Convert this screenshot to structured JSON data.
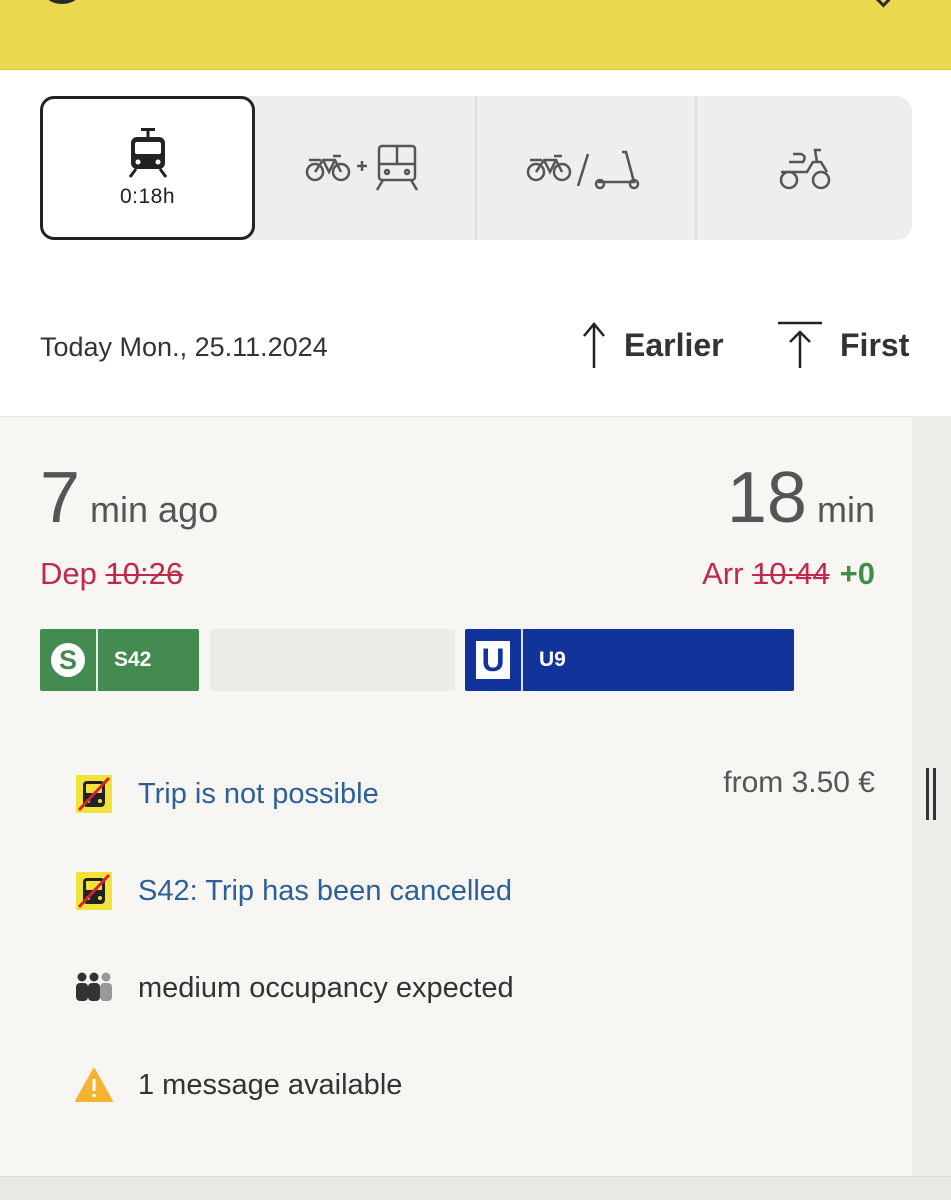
{
  "modes": {
    "public_transport": {
      "duration": "0:18h"
    }
  },
  "date_bar": {
    "date_text": "Today Mon., 25.11.2024",
    "earlier_label": "Earlier",
    "first_label": "First"
  },
  "trip": {
    "departure_relative_value": "7",
    "departure_relative_unit": "min ago",
    "arrival_relative_value": "18",
    "arrival_relative_unit": "min",
    "departure_prefix": "Dep",
    "departure_time": "10:26",
    "arrival_prefix": "Arr",
    "arrival_time": "10:44",
    "arrival_delay": "+0",
    "legs": [
      {
        "badge": "S",
        "line": "S42",
        "color": "#438b51"
      },
      {
        "badge": "U",
        "line": "U9",
        "color": "#12339a"
      }
    ],
    "price": "from 3.50  €",
    "infos": [
      {
        "text": "Trip is not possible",
        "icon": "cancelled-icon"
      },
      {
        "text": "S42: Trip has been cancelled",
        "icon": "cancelled-icon"
      },
      {
        "text": "medium occupancy expected",
        "icon": "occupancy-icon"
      },
      {
        "text": "1 message available",
        "icon": "warning-icon"
      }
    ]
  },
  "colors": {
    "header_yellow": "#ebd84e",
    "delay_red": "#c0294a",
    "ontime_green": "#3d8f46",
    "link_blue": "#2d5f9a"
  }
}
